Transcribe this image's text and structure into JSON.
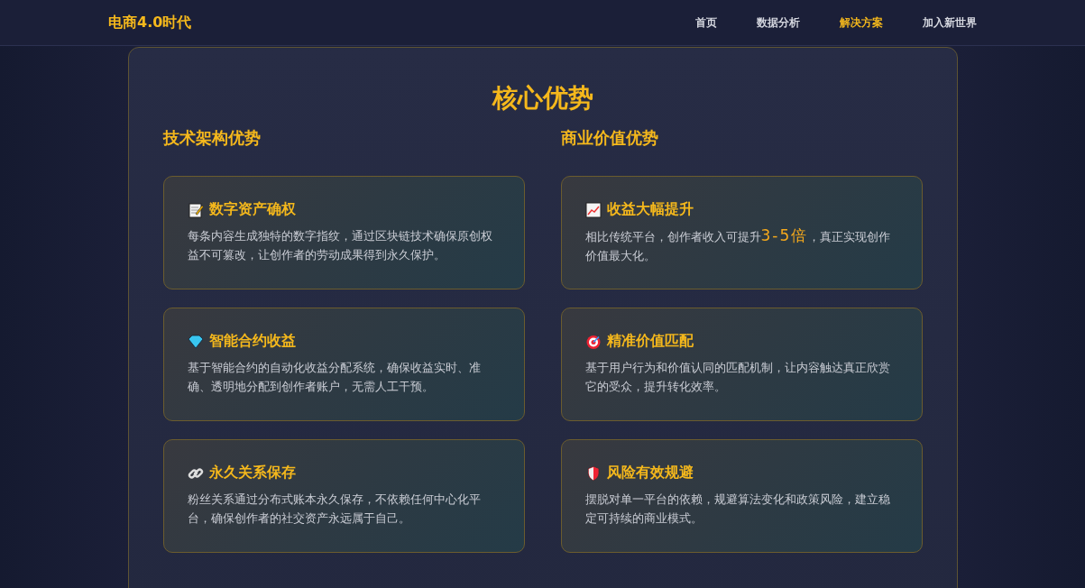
{
  "nav": {
    "logo": "电商4.0时代",
    "items": [
      {
        "label": "首页",
        "selected": false
      },
      {
        "label": "数据分析",
        "selected": false
      },
      {
        "label": "解决方案",
        "selected": true
      },
      {
        "label": "加入新世界",
        "selected": false
      }
    ]
  },
  "panel": {
    "title": "核心优势",
    "columns": [
      {
        "heading": "技术架构优势",
        "cards": [
          {
            "title": "数字资产确权",
            "text": "每条内容生成独特的数字指纹，通过区块链技术确保原创权益不可篡改，让创作者的劳动成果得到永久保护。"
          },
          {
            "title": "智能合约收益",
            "text": "基于智能合约的自动化收益分配系统，确保收益实时、准确、透明地分配到创作者账户，无需人工干预。"
          },
          {
            "title": "永久关系保存",
            "text": "粉丝关系通过分布式账本永久保存，不依赖任何中心化平台，确保创作者的社交资产永远属于自己。"
          }
        ]
      },
      {
        "heading": "商业价值优势",
        "cards": [
          {
            "title": "收益大幅提升",
            "text": "相比传统平台，创作者收入可提升**3-5倍**，真正实现创作价值最大化。"
          },
          {
            "title": "精准价值匹配",
            "text": "基于用户行为和价值认同的匹配机制，让内容触达真正欣赏它的受众，提升转化效率。"
          },
          {
            "title": "风险有效规避",
            "text": "摆脱对单一平台的依赖，规避算法变化和政策风险，建立稳定可持续的商业模式。"
          }
        ]
      }
    ]
  }
}
